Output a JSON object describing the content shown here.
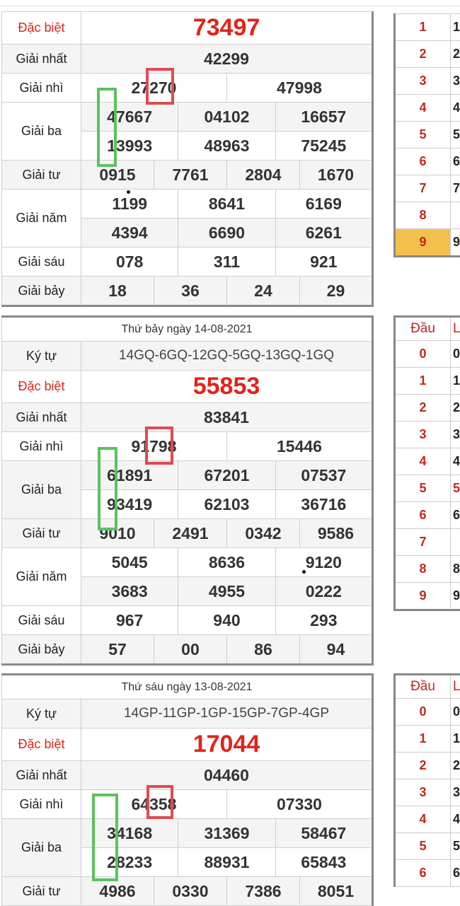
{
  "b1": {
    "db_lbl": "Đặc biệt",
    "db": "73497",
    "g1_lbl": "Giải nhất",
    "g1": "42299",
    "g2_lbl": "Giải nhì",
    "g2": [
      "27270",
      "47998"
    ],
    "g3_lbl": "Giải ba",
    "g3": [
      "47667",
      "04102",
      "16657",
      "13993",
      "48963",
      "75245"
    ],
    "g4_lbl": "Giải tư",
    "g4": [
      "0915",
      "7761",
      "2804",
      "1670"
    ],
    "g5_lbl": "Giải năm",
    "g5": [
      "1199",
      "8641",
      "6169",
      "4394",
      "6690",
      "6261"
    ],
    "g6_lbl": "Giải sáu",
    "g6": [
      "078",
      "311",
      "921"
    ],
    "g7_lbl": "Giải bảy",
    "g7": [
      "18",
      "36",
      "24",
      "29"
    ]
  },
  "b2": {
    "date": "Thứ bảy ngày 14-08-2021",
    "kt_lbl": "Ký tự",
    "kt": "14GQ-6GQ-12GQ-5GQ-13GQ-1GQ",
    "db_lbl": "Đặc biệt",
    "db": "55853",
    "g1_lbl": "Giải nhất",
    "g1": "83841",
    "g2_lbl": "Giải nhì",
    "g2": [
      "91798",
      "15446"
    ],
    "g3_lbl": "Giải ba",
    "g3": [
      "61891",
      "67201",
      "07537",
      "93419",
      "62103",
      "36716"
    ],
    "g4_lbl": "Giải tư",
    "g4": [
      "9010",
      "2491",
      "0342",
      "9586"
    ],
    "g5_lbl": "Giải năm",
    "g5": [
      "5045",
      "8636",
      "9120",
      "3683",
      "4955",
      "0222"
    ],
    "g6_lbl": "Giải sáu",
    "g6": [
      "967",
      "940",
      "293"
    ],
    "g7_lbl": "Giải bảy",
    "g7": [
      "57",
      "00",
      "86",
      "94"
    ]
  },
  "b3": {
    "date": "Thứ sáu ngày 13-08-2021",
    "kt_lbl": "Ký tự",
    "kt": "14GP-11GP-1GP-15GP-7GP-4GP",
    "db_lbl": "Đặc biệt",
    "db": "17044",
    "g1_lbl": "Giải nhất",
    "g1": "04460",
    "g2_lbl": "Giải nhì",
    "g2": [
      "64358",
      "07330"
    ],
    "g3_lbl": "Giải ba",
    "g3": [
      "34168",
      "31369",
      "58467",
      "28233",
      "88931",
      "65843"
    ],
    "g4_lbl": "Giải tư",
    "g4": [
      "4986",
      "0330",
      "7386",
      "8051"
    ]
  },
  "s1": {
    "rows": [
      [
        "1",
        "1"
      ],
      [
        "2",
        "2"
      ],
      [
        "3",
        "3"
      ],
      [
        "4",
        "4"
      ],
      [
        "5",
        "5"
      ],
      [
        "6",
        "6"
      ],
      [
        "7",
        "7"
      ],
      [
        "8",
        ""
      ],
      [
        "9",
        "9"
      ]
    ]
  },
  "s2": {
    "h": [
      "Đầu",
      "L"
    ],
    "rows": [
      [
        "0",
        "0"
      ],
      [
        "1",
        "1"
      ],
      [
        "2",
        "2"
      ],
      [
        "3",
        "3"
      ],
      [
        "4",
        "4"
      ],
      [
        "5",
        "5"
      ],
      [
        "6",
        "6"
      ],
      [
        "7",
        ""
      ],
      [
        "8",
        "8"
      ],
      [
        "9",
        "9"
      ]
    ]
  },
  "s3": {
    "h": [
      "Đầu",
      "L"
    ],
    "rows": [
      [
        "0",
        "0"
      ],
      [
        "1",
        "1"
      ],
      [
        "2",
        "2"
      ],
      [
        "3",
        "3"
      ],
      [
        "4",
        "4"
      ],
      [
        "5",
        "5"
      ],
      [
        "6",
        "6"
      ]
    ]
  },
  "colors": {
    "red": "#e2231a",
    "green_box": "#5bc25f",
    "red_box": "#e04b52",
    "highlight": "#f2c04b"
  }
}
